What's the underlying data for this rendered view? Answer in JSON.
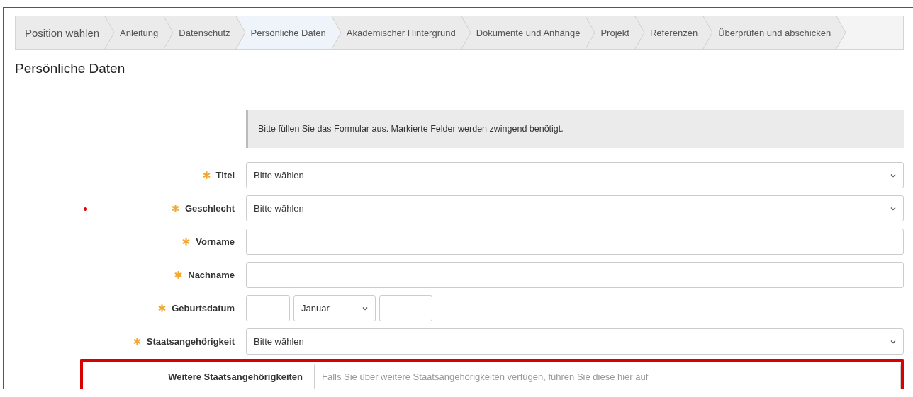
{
  "steps": [
    {
      "label": "Position wählen",
      "selected": false
    },
    {
      "label": "Anleitung",
      "selected": false
    },
    {
      "label": "Datenschutz",
      "selected": false
    },
    {
      "label": "Persönliche Daten",
      "selected": true
    },
    {
      "label": "Akademischer Hintergrund",
      "selected": false
    },
    {
      "label": "Dokumente und Anhänge",
      "selected": false
    },
    {
      "label": "Projekt",
      "selected": false
    },
    {
      "label": "Referenzen",
      "selected": false
    },
    {
      "label": "Überprüfen und abschicken",
      "selected": false
    }
  ],
  "heading": "Persönliche Daten",
  "notice": "Bitte füllen Sie das Formular aus. Markierte Felder werden zwingend benötigt.",
  "fields": [
    {
      "kind": "select",
      "label": "Titel",
      "required": true,
      "flagged": false,
      "highlighted": false,
      "value": "Bitte wählen"
    },
    {
      "kind": "select",
      "label": "Geschlecht",
      "required": true,
      "flagged": true,
      "highlighted": false,
      "value": "Bitte wählen"
    },
    {
      "kind": "text",
      "label": "Vorname",
      "required": true,
      "flagged": false,
      "highlighted": false
    },
    {
      "kind": "text",
      "label": "Nachname",
      "required": true,
      "flagged": false,
      "highlighted": false
    },
    {
      "kind": "date",
      "label": "Geburtsdatum",
      "required": true,
      "flagged": false,
      "highlighted": false,
      "month": "Januar"
    },
    {
      "kind": "select",
      "label": "Staatsangehörigkeit",
      "required": true,
      "flagged": false,
      "highlighted": false,
      "value": "Bitte wählen"
    },
    {
      "kind": "text",
      "label": "Weitere Staatsangehörigkeiten",
      "required": false,
      "flagged": false,
      "highlighted": true,
      "placeholder": "Falls Sie über weitere Staatsangehörigkeiten verfügen, führen Sie diese hier auf"
    }
  ]
}
